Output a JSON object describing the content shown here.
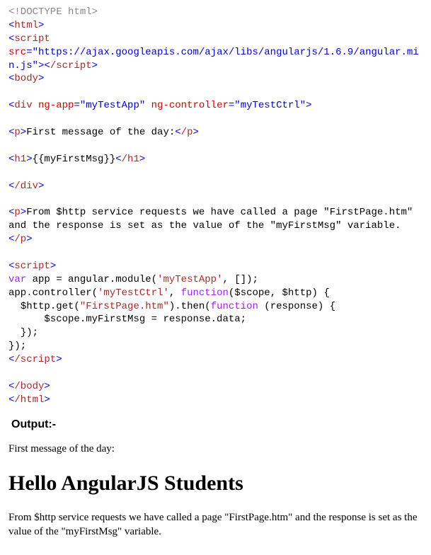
{
  "code": {
    "l1": "<!DOCTYPE html>",
    "l2a": "<",
    "l2b": "html",
    "l2c": ">",
    "l3a": "<",
    "l3b": "script",
    "l3c": " src",
    "l3d": "=",
    "l3e": "\"https://ajax.googleapis.com/ajax/libs/angularjs/1.6.9/angular.min.js\"",
    "l3f": "><",
    "l3g": "/script",
    "l3h": ">",
    "l4a": "<",
    "l4b": "body",
    "l4c": ">",
    "l6a": "<",
    "l6b": "div",
    "l6c": " ng-app",
    "l6d": "=",
    "l6e": "\"myTestApp\"",
    "l6f": " ng-controller",
    "l6g": "=",
    "l6h": "\"myTestCtrl\"",
    "l6i": ">",
    "l8a": "<",
    "l8b": "p",
    "l8c": ">",
    "l8d": "First message of the day:",
    "l8e": "<",
    "l8f": "/p",
    "l8g": ">",
    "l10a": "<",
    "l10b": "h1",
    "l10c": ">",
    "l10d": "{{myFirstMsg}}",
    "l10e": "<",
    "l10f": "/h1",
    "l10g": ">",
    "l12a": "<",
    "l12b": "/div",
    "l12c": ">",
    "l14a": "<",
    "l14b": "p",
    "l14c": ">",
    "l14d": "From $http service requests we have called a page \"FirstPage.htm\" and the response is set as the value of the \"myFirstMsg\" variable.",
    "l14e": "<",
    "l14f": "/p",
    "l14g": ">",
    "l16a": "<",
    "l16b": "script",
    "l16c": ">",
    "l17a": "var",
    "l17b": " app = angular.module(",
    "l17c": "'myTestApp'",
    "l17d": ", []);",
    "l18a": "app.controller(",
    "l18b": "'myTestCtrl'",
    "l18c": ", ",
    "l18d": "function",
    "l18e": "($scope, $http) {",
    "l19a": "  $http.get(",
    "l19b": "\"FirstPage.htm\"",
    "l19c": ").then(",
    "l19d": "function",
    "l19e": " (response) {",
    "l20": "      $scope.myFirstMsg = response.data;",
    "l21": "  });",
    "l22": "});",
    "l23a": "<",
    "l23b": "/script",
    "l23c": ">",
    "l25a": "<",
    "l25b": "/body",
    "l25c": ">",
    "l26a": "<",
    "l26b": "/html",
    "l26c": ">"
  },
  "output": {
    "label": "Output:-",
    "p1": "First message of the day:",
    "h1": "Hello AngularJS Students",
    "p2": "From $http service requests we have called a page \"FirstPage.htm\" and the response is set as the value of the \"myFirstMsg\" variable."
  }
}
